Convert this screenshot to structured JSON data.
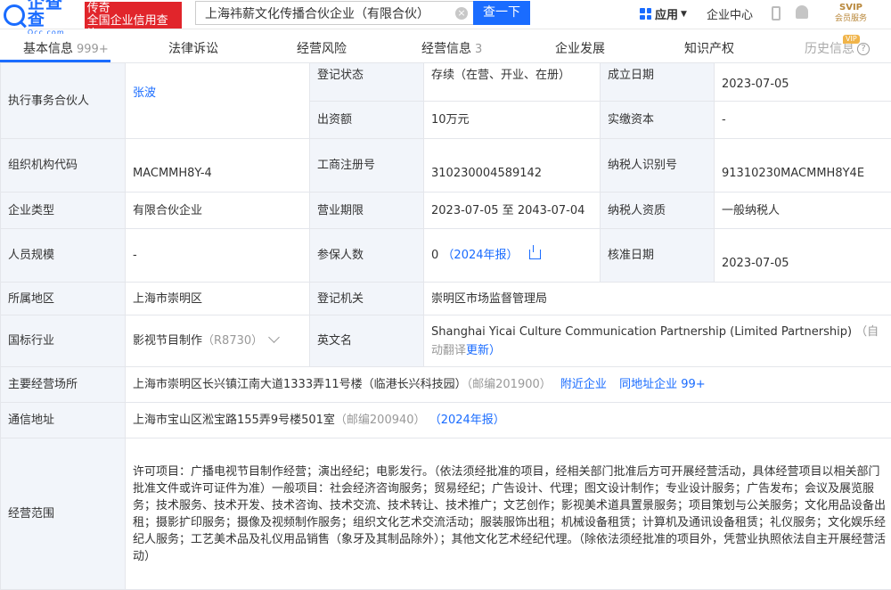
{
  "header": {
    "logo_name": "企查查",
    "logo_domain": "Qcc.com",
    "logo_badge_line1": "传奇",
    "logo_badge_line2": "全国企业信用查询",
    "search_value": "上海祎薪文化传播合伙企业（有限合伙）",
    "search_button": "查一下",
    "apps_label": "应用",
    "enterprise_center": "企业中心",
    "vip_top": "SVIP",
    "vip_bottom": "会员服务"
  },
  "tabs": [
    {
      "label": "基本信息",
      "count": "999+"
    },
    {
      "label": "法律诉讼",
      "count": ""
    },
    {
      "label": "经营风险",
      "count": ""
    },
    {
      "label": "经营信息",
      "count": "3"
    },
    {
      "label": "企业发展",
      "count": ""
    },
    {
      "label": "知识产权",
      "count": ""
    },
    {
      "label": "历史信息",
      "count": ""
    }
  ],
  "vip_tag": "VIP",
  "info": {
    "partner_label": "执行事务合伙人",
    "partner_value": "张波",
    "reg_status_label": "登记状态",
    "reg_status_value": "存续（在营、开业、在册）",
    "found_date_label": "成立日期",
    "found_date_value": "2023-07-05",
    "capital_label": "出资额",
    "capital_value": "10万元",
    "paid_capital_label": "实缴资本",
    "paid_capital_value": "-",
    "org_code_label": "组织机构代码",
    "org_code_value": "MACMMH8Y-4",
    "biz_reg_label": "工商注册号",
    "biz_reg_value": "310230004589142",
    "tax_id_label": "纳税人识别号",
    "tax_id_value": "91310230MACMMH8Y4E",
    "type_label": "企业类型",
    "type_value": "有限合伙企业",
    "term_label": "营业期限",
    "term_value": "2023-07-05 至 2043-07-04",
    "tax_qual_label": "纳税人资质",
    "tax_qual_value": "一般纳税人",
    "staff_label": "人员规模",
    "staff_value": "-",
    "insured_label": "参保人数",
    "insured_value": "0",
    "insured_report": "（2024年报）",
    "approve_label": "核准日期",
    "approve_value": "2023-07-05",
    "region_label": "所属地区",
    "region_value": "上海市崇明区",
    "authority_label": "登记机关",
    "authority_value": "崇明区市场监督管理局",
    "industry_label": "国标行业",
    "industry_value": "影视节目制作",
    "industry_code": "（R8730）",
    "english_label": "英文名",
    "english_value": "Shanghai Yicai Culture Communication Partnership (Limited Partnership)",
    "english_auto": "（自动翻译",
    "english_update": "更新）",
    "address_label": "主要经营场所",
    "address_value": "上海市崇明区长兴镇江南大道1333弄11号楼（临港长兴科技园）",
    "address_zip": "（邮编201900）",
    "address_nearby": "附近企业",
    "address_same": "同地址企业 99+",
    "mail_label": "通信地址",
    "mail_value": "上海市宝山区淞宝路155弄9号楼501室",
    "mail_zip": "（邮编200940）",
    "mail_report": "（2024年报）",
    "scope_label": "经营范围",
    "scope_value": "许可项目：广播电视节目制作经营；演出经纪；电影发行。（依法须经批准的项目，经相关部门批准后方可开展经营活动，具体经营项目以相关部门批准文件或许可证件为准）一般项目：社会经济咨询服务；贸易经纪；广告设计、代理；图文设计制作；专业设计服务；广告发布；会议及展览服务；技术服务、技术开发、技术咨询、技术交流、技术转让、技术推广；文艺创作；影视美术道具置景服务；项目策划与公关服务；文化用品设备出租；摄影扩印服务；摄像及视频制作服务；组织文化艺术交流活动；服装服饰出租；机械设备租赁；计算机及通讯设备租赁；礼仪服务；文化娱乐经纪人服务；工艺美术品及礼仪用品销售（象牙及其制品除外）；其他文化艺术经纪代理。（除依法须经批准的项目外，凭营业执照依法自主开展经营活动）"
  }
}
